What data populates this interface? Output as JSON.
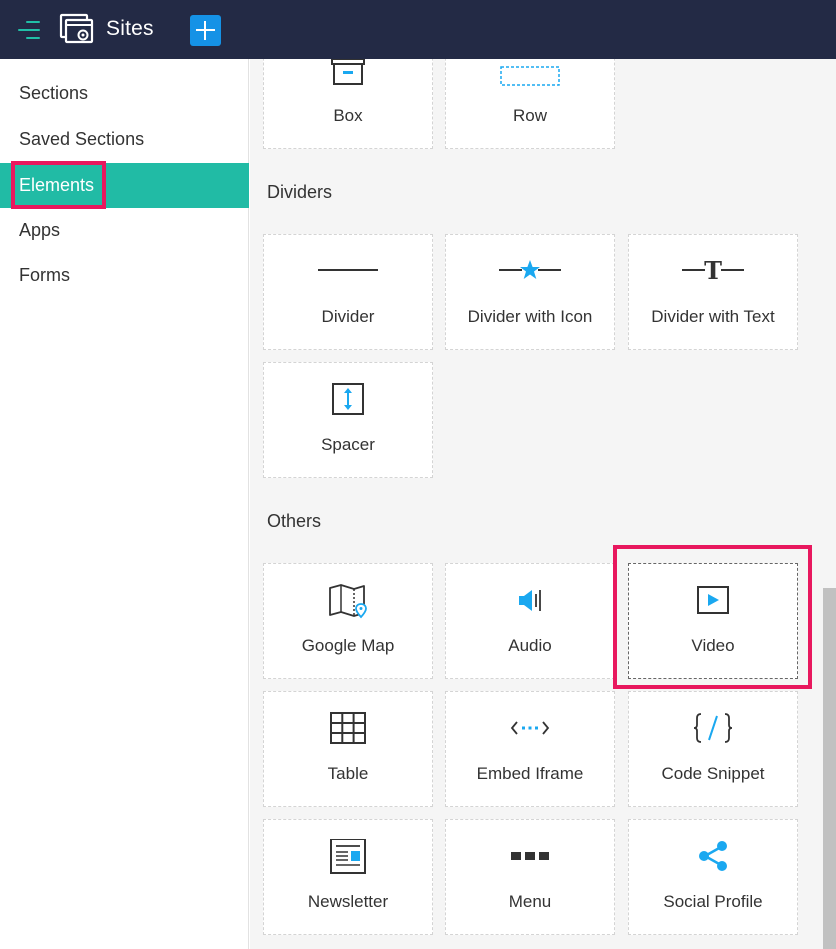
{
  "header": {
    "title": "Sites"
  },
  "sidebar": {
    "items": [
      {
        "label": "Sections"
      },
      {
        "label": "Saved Sections"
      },
      {
        "label": "Elements"
      },
      {
        "label": "Apps"
      },
      {
        "label": "Forms"
      }
    ],
    "active_item": "Elements"
  },
  "main": {
    "layout_tiles": [
      {
        "label": "Box",
        "icon": "box-icon"
      },
      {
        "label": "Row",
        "icon": "row-icon"
      }
    ],
    "dividers": {
      "title": "Dividers",
      "tiles": [
        {
          "label": "Divider",
          "icon": "divider-icon"
        },
        {
          "label": "Divider with Icon",
          "icon": "divider-star-icon"
        },
        {
          "label": "Divider with Text",
          "icon": "divider-text-icon"
        },
        {
          "label": "Spacer",
          "icon": "spacer-icon"
        }
      ]
    },
    "others": {
      "title": "Others",
      "tiles": [
        {
          "label": "Google Map",
          "icon": "map-icon"
        },
        {
          "label": "Audio",
          "icon": "audio-icon"
        },
        {
          "label": "Video",
          "icon": "video-icon"
        },
        {
          "label": "Table",
          "icon": "table-icon"
        },
        {
          "label": "Embed Iframe",
          "icon": "embed-icon"
        },
        {
          "label": "Code Snippet",
          "icon": "code-icon"
        },
        {
          "label": "Newsletter",
          "icon": "newsletter-icon"
        },
        {
          "label": "Menu",
          "icon": "menu-icon"
        },
        {
          "label": "Social Profile",
          "icon": "share-icon"
        }
      ]
    }
  },
  "colors": {
    "topbar": "#232a45",
    "accent": "#21bba5",
    "icon_blue": "#1aa8f0",
    "highlight": "#e8185e",
    "add_button": "#1592e6"
  }
}
